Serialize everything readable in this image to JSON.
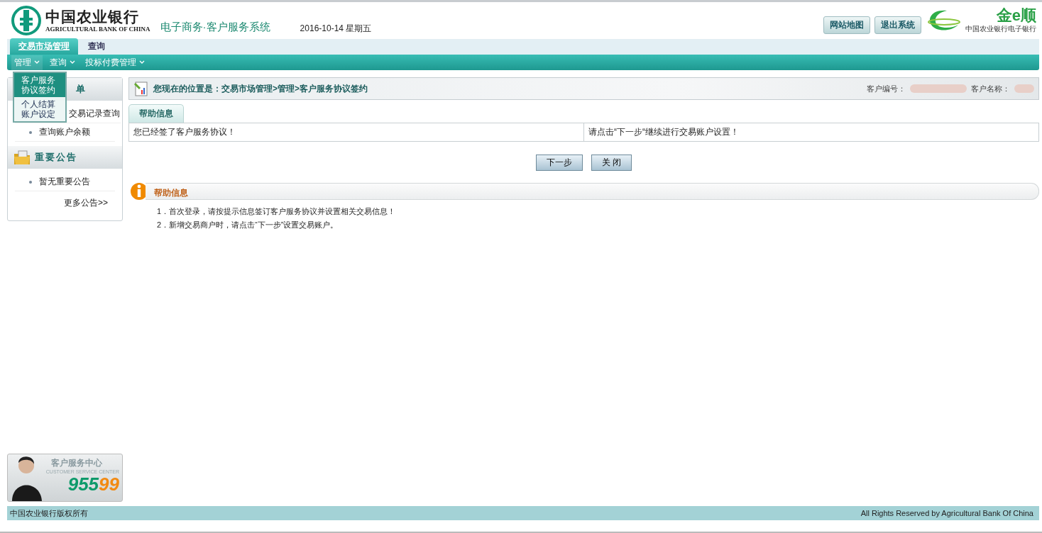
{
  "header": {
    "bank_name": "中国农业银行",
    "bank_name_en": "AGRICULTURAL BANK OF CHINA",
    "system_title": "电子商务·客户服务系统",
    "date": "2016-10-14 星期五",
    "buttons": [
      "网站地图",
      "退出系统"
    ],
    "brand": {
      "name": "金e顺",
      "subtitle": "中国农业银行电子银行"
    }
  },
  "tabs": [
    {
      "label": "交易市场管理",
      "selected": true
    },
    {
      "label": "查询",
      "selected": false
    }
  ],
  "menu_bar": [
    {
      "label": "管理",
      "expanded": true
    },
    {
      "label": "查询",
      "expanded": false
    },
    {
      "label": "投标付费管理",
      "expanded": false
    }
  ],
  "dropdown": [
    {
      "label": "客户服务协议签约",
      "selected": true
    },
    {
      "label": "个人结算账户设定",
      "selected": false
    }
  ],
  "sidebar": {
    "menu": {
      "title": "单",
      "items": [
        "交易记录查询",
        "查询账户余额"
      ]
    },
    "notices": {
      "title": "重要公告",
      "items": [
        "暂无重要公告"
      ],
      "more": "更多公告>>"
    },
    "service_banner": {
      "title": "客户服务中心",
      "subtitle": "CUSTOMER SERVICE CENTER",
      "phone_head": "955",
      "phone_tail": "99"
    }
  },
  "breadcrumb": {
    "prefix": "您现在的位置是：",
    "path": "交易市场管理>管理>客户服务协议签约",
    "customer_id_label": "客户编号：",
    "customer_name_label": "客户名称："
  },
  "info_tab": "帮助信息",
  "info_row": [
    "您已经签了客户服务协议！",
    "请点击“下一步“继续进行交易账户设置！"
  ],
  "actions": [
    "下一步",
    "关 闭"
  ],
  "help": {
    "title": "帮助信息",
    "lines": [
      "1．首次登录，请按提示信息签订客户服务协议并设置相关交易信息！",
      "2．新增交易商户时，请点击“下一步”设置交易账户。"
    ]
  },
  "footer": {
    "left": "中国农业银行版权所有",
    "right": "All Rights Reserved by Agricultural Bank Of China"
  }
}
